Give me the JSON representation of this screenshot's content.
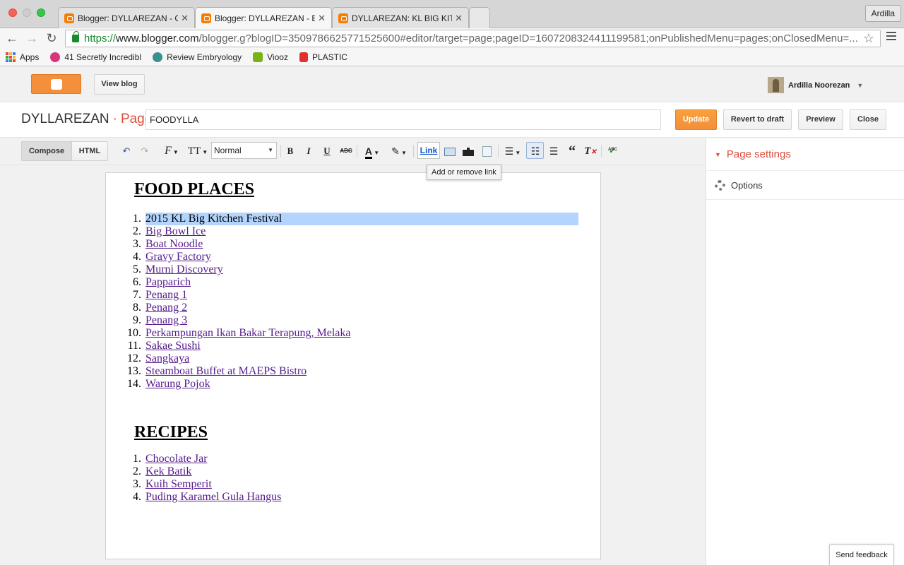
{
  "browser": {
    "profile": "Ardilla",
    "tabs": [
      {
        "title": "Blogger: DYLLAREZAN - Co",
        "close": "✕"
      },
      {
        "title": "Blogger: DYLLAREZAN - Ed",
        "close": "✕"
      },
      {
        "title": "DYLLAREZAN: KL BIG KITCH",
        "close": "✕"
      }
    ],
    "url": {
      "scheme": "https://",
      "host": "www.blogger.com",
      "path": "/blogger.g?blogID=3509786625771525600#editor/target=page;pageID=1607208324411199581;onPublishedMenu=pages;onClosedMenu=..."
    },
    "bookmarks": [
      {
        "label": "Apps",
        "color": "#e8453c"
      },
      {
        "label": "41 Secretly Incredibl",
        "color": "#d8367a"
      },
      {
        "label": "Review Embryology",
        "color": "#3a8f8f"
      },
      {
        "label": "Viooz",
        "color": "#7ab317"
      },
      {
        "label": "PLASTIC",
        "color": "#e0312b"
      }
    ]
  },
  "header": {
    "view_blog": "View blog",
    "user_name": "Ardilla Noorezan"
  },
  "editbar": {
    "blog_name": "DYLLAREZAN",
    "separator": "·",
    "section": "Page",
    "title_value": "FOODYLLA",
    "update": "Update",
    "revert": "Revert to draft",
    "preview": "Preview",
    "close": "Close"
  },
  "toolbar": {
    "compose": "Compose",
    "html": "HTML",
    "format_value": "Normal",
    "link": "Link",
    "tooltip": "Add or remove link",
    "bold": "B",
    "italic": "I",
    "underline": "U",
    "strike": "ABC",
    "font_letter": "F",
    "size_letter": "TT",
    "text_color_letter": "A",
    "spell_label": "ABC"
  },
  "document": {
    "section1_title": "FOOD PLACES",
    "food_places": [
      {
        "num": "1.",
        "text": "2015 KL Big Kitchen Festival"
      },
      {
        "num": "2.",
        "text": "Big Bowl Ice"
      },
      {
        "num": "3.",
        "text": "Boat Noodle"
      },
      {
        "num": "4.",
        "text": "Gravy Factory"
      },
      {
        "num": "5.",
        "text": "Murni Discovery"
      },
      {
        "num": "6.",
        "text": "Papparich"
      },
      {
        "num": "7.",
        "text": "Penang 1"
      },
      {
        "num": "8.",
        "text": "Penang 2"
      },
      {
        "num": "9.",
        "text": "Penang 3"
      },
      {
        "num": "10.",
        "text": "Perkampungan Ikan Bakar Terapung, Melaka"
      },
      {
        "num": "11.",
        "text": "Sakae Sushi"
      },
      {
        "num": "12.",
        "text": "Sangkaya"
      },
      {
        "num": "13.",
        "text": "Steamboat Buffet at MAEPS Bistro"
      },
      {
        "num": "14.",
        "text": "Warung Pojok"
      }
    ],
    "section2_title": "RECIPES",
    "recipes": [
      {
        "num": "1.",
        "text": "Chocolate Jar"
      },
      {
        "num": "2.",
        "text": "Kek Batik"
      },
      {
        "num": "3.",
        "text": "Kuih Semperit"
      },
      {
        "num": "4.",
        "text": "Puding Karamel Gula Hangus"
      }
    ]
  },
  "sidepanel": {
    "page_settings": "Page settings",
    "options": "Options"
  },
  "feedback": "Send feedback",
  "colors": {
    "blogger_orange": "#f48f3c",
    "accent_red": "#dd4b39",
    "link_visited": "#551a8b",
    "selection": "#b3d4fc"
  }
}
